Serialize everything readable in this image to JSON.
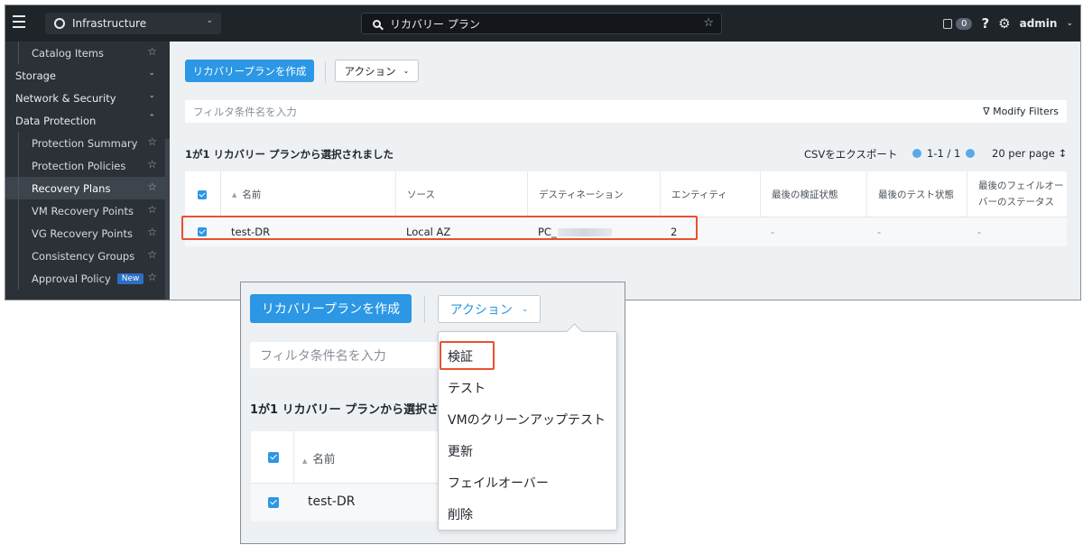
{
  "topbar": {
    "app_name": "Infrastructure",
    "search_value": "リカバリー プラン",
    "task_count": "0",
    "help_label": "?",
    "user_name": "admin"
  },
  "sidebar": {
    "items": [
      {
        "label": "Catalog Items",
        "type": "child"
      },
      {
        "label": "Storage",
        "type": "section"
      },
      {
        "label": "Network & Security",
        "type": "section"
      },
      {
        "label": "Data Protection",
        "type": "section"
      },
      {
        "label": "Protection Summary",
        "type": "child"
      },
      {
        "label": "Protection Policies",
        "type": "child"
      },
      {
        "label": "Recovery Plans",
        "type": "child",
        "active": true
      },
      {
        "label": "VM Recovery Points",
        "type": "child"
      },
      {
        "label": "VG Recovery Points",
        "type": "child"
      },
      {
        "label": "Consistency Groups",
        "type": "child"
      },
      {
        "label": "Approval Policy",
        "type": "child",
        "badge": "New"
      }
    ]
  },
  "toolbar": {
    "create_label": "リカバリープランを作成",
    "action_label": "アクション"
  },
  "filter": {
    "placeholder": "フィルタ条件名を入力",
    "modify_label": "Modify Filters"
  },
  "summary": {
    "selection_text": "1が1 リカバリー プランから選択されました",
    "csv_label": "CSVをエクスポート",
    "pagination": "1-1 / 1",
    "per_page": "20 per page"
  },
  "table": {
    "columns": [
      "名前",
      "ソース",
      "デスティネーション",
      "エンティティ",
      "最後の検証状態",
      "最後のテスト状態",
      "最後のフェイルオーバーのステータス"
    ],
    "rows": [
      {
        "name": "test-DR",
        "source": "Local AZ",
        "destination": "PC_",
        "entities": "2",
        "last_validation": "-",
        "last_test": "-",
        "last_failover": "-"
      }
    ]
  },
  "zoom": {
    "create_label": "リカバリープランを作成",
    "action_label": "アクション",
    "filter_placeholder": "フィルタ条件名を入力",
    "selection_text": "1が1 リカバリー プランから選択さ",
    "column_name": "名前",
    "row_name": "test-DR",
    "menu_items": [
      "検証",
      "テスト",
      "VMのクリーンアップテスト",
      "更新",
      "フェイルオーバー",
      "削除"
    ]
  },
  "colors": {
    "accent": "#2c97e4",
    "highlight": "#e8512f",
    "topbar_bg": "#1f2429",
    "sidebar_bg": "#2b3137"
  }
}
